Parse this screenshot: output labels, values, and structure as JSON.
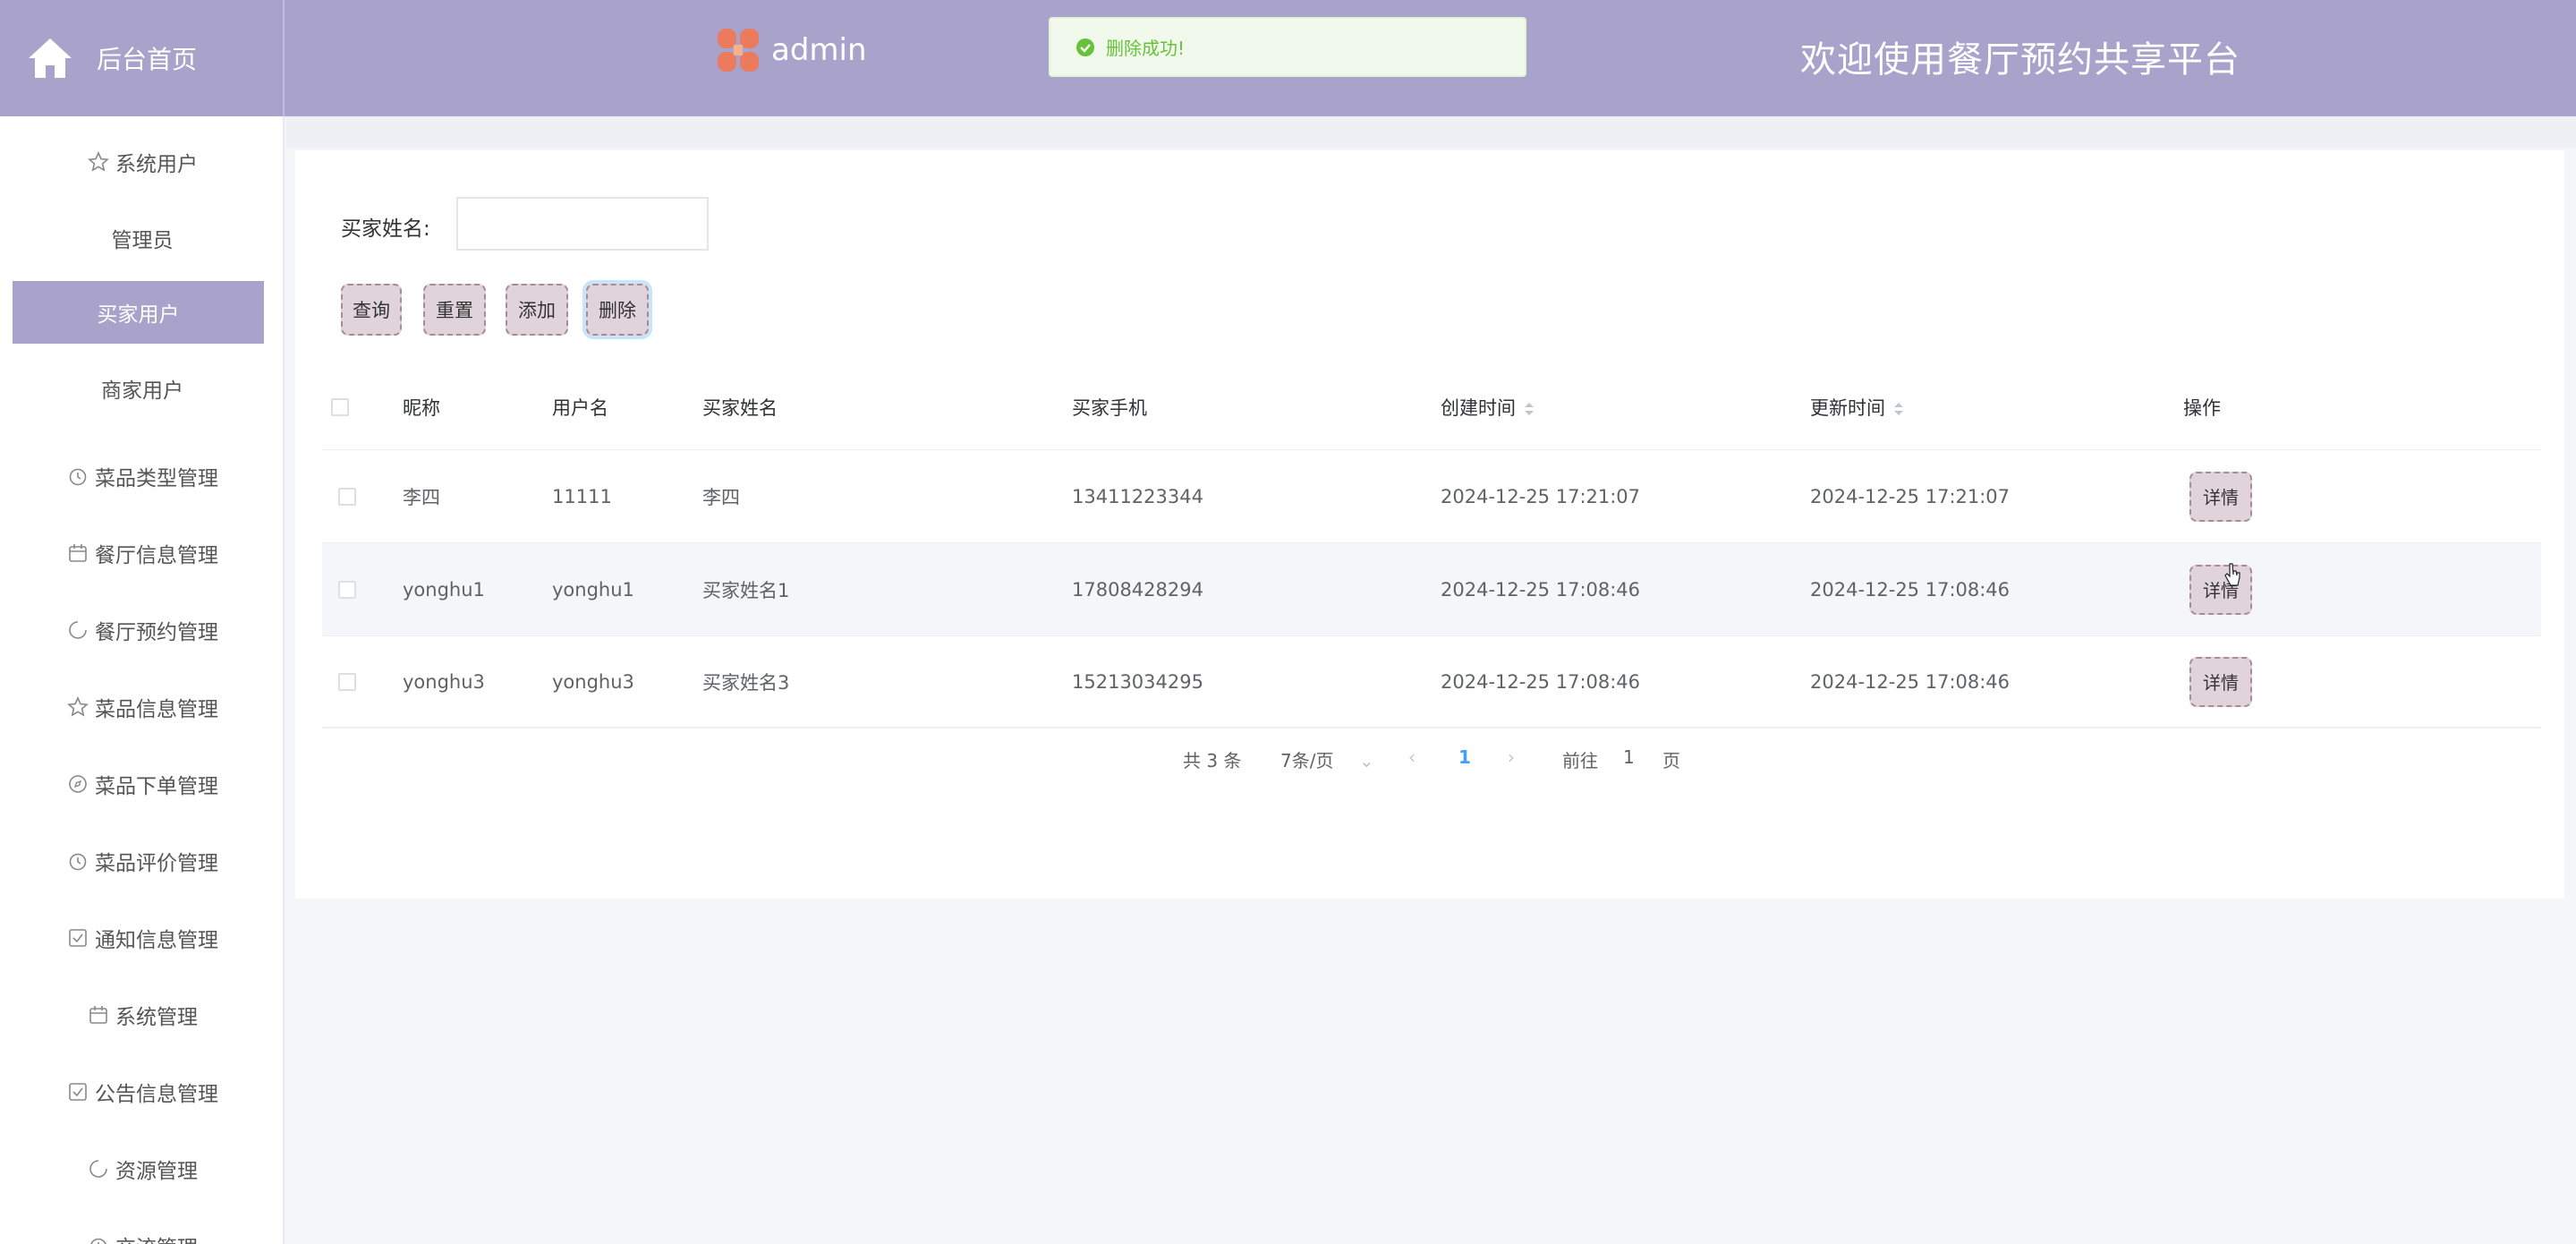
{
  "header": {
    "home_label": "后台首页",
    "user_name": "admin",
    "toast_text": "删除成功!",
    "site_title": "欢迎使用餐厅预约共享平台"
  },
  "sidebar": {
    "items": [
      {
        "label": "系统用户",
        "icon": "star-icon"
      },
      {
        "label": "管理员",
        "icon": ""
      },
      {
        "label": "买家用户",
        "icon": "",
        "active": true
      },
      {
        "label": "商家用户",
        "icon": ""
      },
      {
        "label": "菜品类型管理",
        "icon": "clock-icon"
      },
      {
        "label": "餐厅信息管理",
        "icon": "calendar-icon"
      },
      {
        "label": "餐厅预约管理",
        "icon": "pie-icon"
      },
      {
        "label": "菜品信息管理",
        "icon": "star-icon"
      },
      {
        "label": "菜品下单管理",
        "icon": "compass-icon"
      },
      {
        "label": "菜品评价管理",
        "icon": "clock-icon"
      },
      {
        "label": "通知信息管理",
        "icon": "check-square-icon"
      },
      {
        "label": "系统管理",
        "icon": "calendar-icon"
      },
      {
        "label": "公告信息管理",
        "icon": "check-square-icon"
      },
      {
        "label": "资源管理",
        "icon": "pie-icon"
      },
      {
        "label": "交流管理",
        "icon": "clock-icon"
      }
    ]
  },
  "search": {
    "label": "买家姓名:",
    "value": "",
    "buttons": {
      "query": "查询",
      "reset": "重置",
      "add": "添加",
      "delete": "删除"
    }
  },
  "table": {
    "headers": {
      "nickname": "昵称",
      "username": "用户名",
      "buyer_name": "买家姓名",
      "phone": "买家手机",
      "created": "创建时间",
      "updated": "更新时间",
      "actions": "操作"
    },
    "detail_label": "详情",
    "rows": [
      {
        "nickname": "李四",
        "username": "11111",
        "buyer_name": "李四",
        "phone": "13411223344",
        "created": "2024-12-25 17:21:07",
        "updated": "2024-12-25 17:21:07"
      },
      {
        "nickname": "yonghu1",
        "username": "yonghu1",
        "buyer_name": "买家姓名1",
        "phone": "17808428294",
        "created": "2024-12-25 17:08:46",
        "updated": "2024-12-25 17:08:46"
      },
      {
        "nickname": "yonghu3",
        "username": "yonghu3",
        "buyer_name": "买家姓名3",
        "phone": "15213034295",
        "created": "2024-12-25 17:08:46",
        "updated": "2024-12-25 17:08:46"
      }
    ]
  },
  "pagination": {
    "total": "共 3 条",
    "page_size": "7条/页",
    "current_page": "1",
    "goto_prefix": "前往",
    "goto_value": "1",
    "goto_suffix": "页"
  },
  "colors": {
    "header_bg": "#a9a3cb",
    "button_bg": "#e0d4da",
    "button_border": "#a98a98",
    "success": "#67c23a",
    "link_active": "#409eff"
  }
}
